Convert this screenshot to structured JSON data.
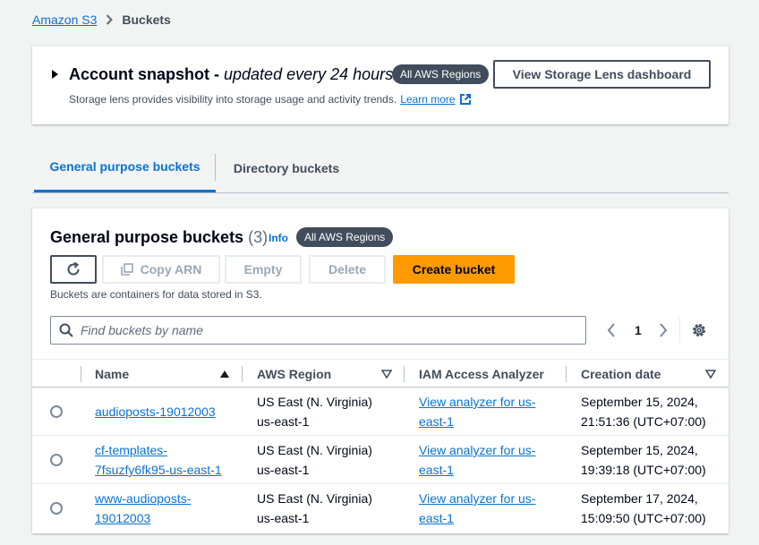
{
  "breadcrumb": {
    "root": "Amazon S3",
    "current": "Buckets"
  },
  "snapshot": {
    "title": "Account snapshot - ",
    "subtitle": "updated every 24 hours",
    "badge": "All AWS Regions",
    "button": "View Storage Lens dashboard",
    "description": "Storage lens provides visibility into storage usage and activity trends.",
    "learn_more": "Learn more"
  },
  "tabs": [
    {
      "label": "General purpose buckets",
      "active": true
    },
    {
      "label": "Directory buckets",
      "active": false
    }
  ],
  "panel": {
    "title": "General purpose buckets",
    "count": "(3)",
    "info": "Info",
    "badge": "All AWS Regions",
    "buttons": {
      "copy_arn": "Copy ARN",
      "empty": "Empty",
      "delete": "Delete",
      "create": "Create bucket"
    },
    "help": "Buckets are containers for data stored in S3.",
    "search_placeholder": "Find buckets by name",
    "page": "1"
  },
  "table": {
    "headers": {
      "name": "Name",
      "region": "AWS Region",
      "iam": "IAM Access Analyzer",
      "date": "Creation date"
    },
    "rows": [
      {
        "name_lines": [
          "audioposts-19012003"
        ],
        "region_lines": [
          "US East (N. Virginia)",
          "us-east-1"
        ],
        "iam_lines": [
          "View analyzer for us-",
          "east-1"
        ],
        "date_lines": [
          "September 15, 2024,",
          "21:51:36 (UTC+07:00)"
        ]
      },
      {
        "name_lines": [
          "cf-templates-",
          "7fsuzfy6fk95-us-east-1"
        ],
        "region_lines": [
          "US East (N. Virginia)",
          "us-east-1"
        ],
        "iam_lines": [
          "View analyzer for us-",
          "east-1"
        ],
        "date_lines": [
          "September 15, 2024,",
          "19:39:18 (UTC+07:00)"
        ]
      },
      {
        "name_lines": [
          "www-audioposts-",
          "19012003"
        ],
        "region_lines": [
          "US East (N. Virginia)",
          "us-east-1"
        ],
        "iam_lines": [
          "View analyzer for us-",
          "east-1"
        ],
        "date_lines": [
          "September 17, 2024,",
          "15:09:50 (UTC+07:00)"
        ]
      }
    ]
  },
  "icons": [
    "chevron-right-icon",
    "caret-right-icon",
    "external-link-icon",
    "refresh-icon",
    "copy-icon",
    "search-icon",
    "angle-left-icon",
    "angle-right-icon",
    "gear-icon",
    "sort-ascending-icon",
    "sort-descending-icon"
  ],
  "colors": {
    "link": "#0972d3",
    "primary_button": "#ff9900",
    "badge": "#414d5c",
    "background": "#f2f3f3"
  }
}
